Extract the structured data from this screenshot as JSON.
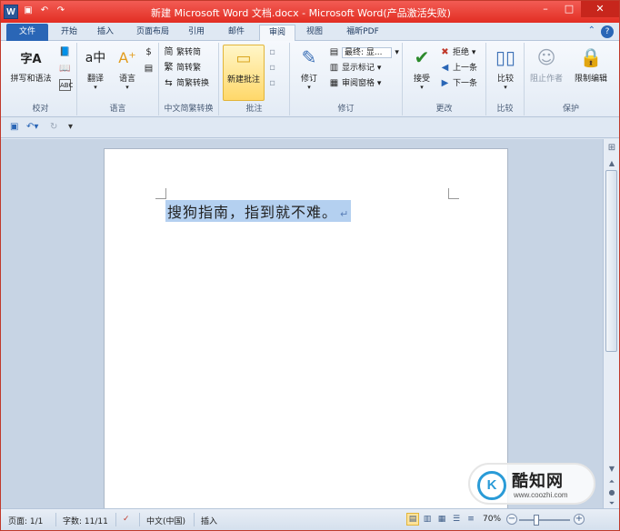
{
  "window": {
    "title": "新建 Microsoft Word 文档.docx - Microsoft Word(产品激活失败)",
    "app_icon_letter": "W",
    "qat_top": [
      "save-icon",
      "undo-icon",
      "redo-icon"
    ],
    "controls": {
      "minimize": "–",
      "maximize": "□",
      "close": "✕"
    }
  },
  "tabs": [
    {
      "label": "文件"
    },
    {
      "label": "开始"
    },
    {
      "label": "插入"
    },
    {
      "label": "页面布局"
    },
    {
      "label": "引用"
    },
    {
      "label": "邮件"
    },
    {
      "label": "审阅",
      "active": true
    },
    {
      "label": "视图"
    },
    {
      "label": "福昕PDF"
    }
  ],
  "help": {
    "minimize_ribbon": "⌃",
    "help_symbol": "?"
  },
  "ribbon": {
    "proofing": {
      "label": "校对",
      "spelling_grammar": "拼写和语法",
      "spelling_icon_text": "字A"
    },
    "language": {
      "label": "语言",
      "translate": "翻译",
      "language": "语言",
      "translate_icon_text": "a中"
    },
    "chinese_conversion": {
      "label": "中文简繁转换",
      "trad_to_simp": "繁转简",
      "simp_to_trad": "简转繁",
      "conversion": "简繁转换",
      "trad_glyph": "繁",
      "simp_glyph": "简"
    },
    "comments": {
      "label": "批注",
      "new_comment": "新建批注"
    },
    "tracking": {
      "label": "修订",
      "track_changes": "修订",
      "display_for_review": "最终: 显...",
      "show_markup": "显示标记",
      "reviewing_pane": "审阅窗格"
    },
    "changes": {
      "label": "更改",
      "accept": "接受",
      "reject": "拒绝",
      "previous": "上一条",
      "next": "下一条"
    },
    "compare": {
      "label": "比较",
      "compare": "比较"
    },
    "protect": {
      "label": "保护",
      "block_authors": "阻止作者",
      "restrict_editing": "限制编辑"
    }
  },
  "document": {
    "text": "搜狗指南，指到就不难。",
    "pilcrow": "↵"
  },
  "statusbar": {
    "page": "页面: 1/1",
    "words": "字数: 11/11",
    "language": "中文(中国)",
    "mode": "插入",
    "zoom": "70%",
    "zoom_level": 70,
    "zoom_minus": "−",
    "zoom_plus": "+"
  },
  "watermark": {
    "logo_text": "K",
    "name": "酷知网",
    "url": "www.coozhi.com"
  },
  "colors": {
    "titlebar": "#e22d23",
    "file_tab": "#2a66b6",
    "selection": "#b4d0f0",
    "highlight_button": "#ffd86a"
  }
}
